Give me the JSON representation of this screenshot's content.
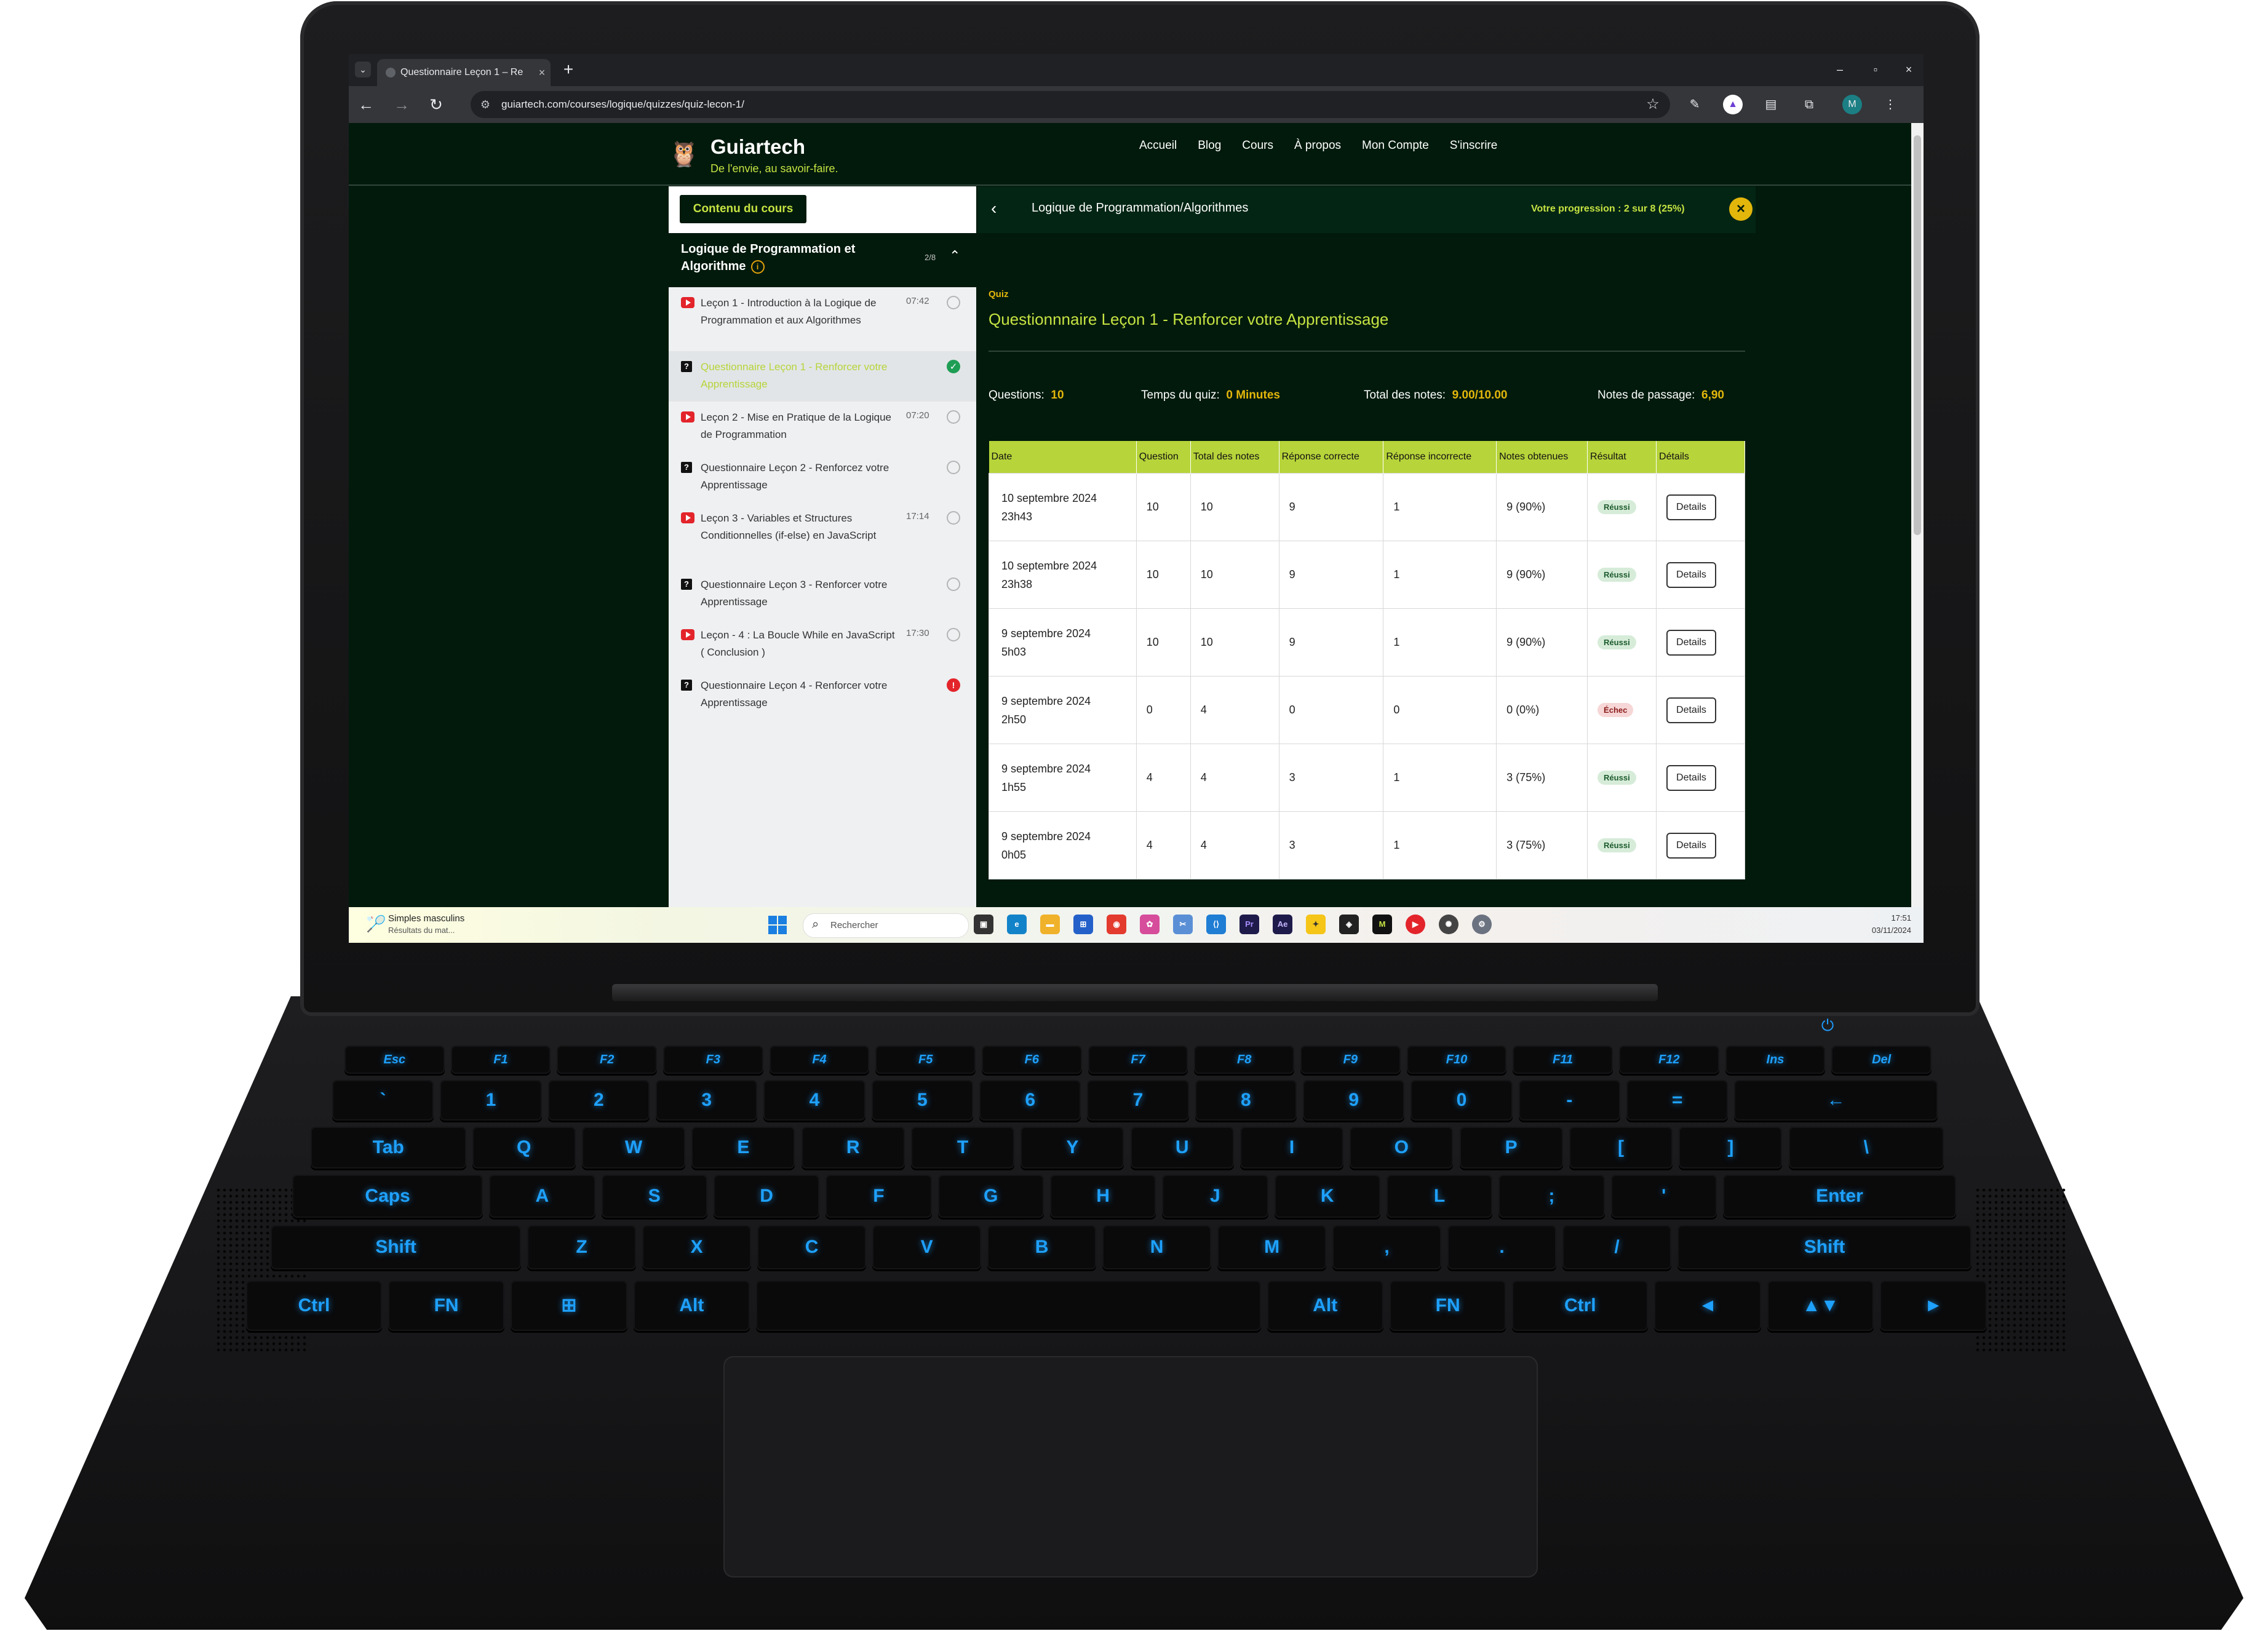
{
  "browser": {
    "tab_title": "Questionnaire Leçon 1 – Re",
    "url": "guiartech.com/courses/logique/quizzes/quiz-lecon-1/",
    "profile_initial": "M"
  },
  "site": {
    "name": "Guiartech",
    "tagline": "De l'envie, au savoir-faire.",
    "nav": [
      "Accueil",
      "Blog",
      "Cours",
      "À propos",
      "Mon Compte",
      "S'inscrire"
    ]
  },
  "sidebar": {
    "button_label": "Contenu du cours",
    "module_title": "Logique de Programmation et Algorithme",
    "module_count": "2/8",
    "lessons": [
      {
        "title": "Leçon 1 - Introduction à la Logique de Programmation et aux Algorithmes",
        "time": "07:42",
        "type": "video",
        "status": "pending"
      },
      {
        "title": "Questionnaire Leçon 1 - Renforcer votre Apprentissage",
        "time": "",
        "type": "quiz",
        "status": "done"
      },
      {
        "title": "Leçon 2 - Mise en Pratique de la Logique de Programmation",
        "time": "07:20",
        "type": "video",
        "status": "pending"
      },
      {
        "title": "Questionnaire Leçon 2 - Renforcez votre Apprentissage",
        "time": "",
        "type": "quiz",
        "status": "pending"
      },
      {
        "title": "Leçon 3 - Variables et Structures Conditionnelles (if-else) en JavaScript",
        "time": "17:14",
        "type": "video",
        "status": "pending"
      },
      {
        "title": "Questionnaire Leçon 3 - Renforcer votre Apprentissage",
        "time": "",
        "type": "quiz",
        "status": "pending"
      },
      {
        "title": "Leçon - 4 : La Boucle While en JavaScript ( Conclusion )",
        "time": "17:30",
        "type": "video",
        "status": "pending"
      },
      {
        "title": "Questionnaire Leçon 4 - Renforcer votre Apprentissage",
        "time": "",
        "type": "quiz",
        "status": "alert"
      }
    ]
  },
  "content": {
    "course_title": "Logique de Programmation/Algorithmes",
    "progress_label": "Votre progression : 2 sur 8 (25%)",
    "quiz_tag": "Quiz",
    "quiz_title": "Questionnnaire Leçon 1 - Renforcer votre Apprentissage",
    "meta": {
      "questions_label": "Questions:",
      "questions_value": "10",
      "time_label": "Temps du quiz:",
      "time_value": "0 Minutes",
      "total_label": "Total des notes:",
      "total_value": "9.00/10.00",
      "pass_label": "Notes de passage:",
      "pass_value": "6,90"
    },
    "table": {
      "headers": [
        "Date",
        "Question",
        "Total des notes",
        "Réponse correcte",
        "Réponse incorrecte",
        "Notes obtenues",
        "Résultat",
        "Détails"
      ],
      "rows": [
        {
          "date": "10 septembre 2024",
          "time": "23h43",
          "question": "10",
          "total": "10",
          "correct": "9",
          "incorrect": "1",
          "obtained": "9 (90%)",
          "result": "Réussi",
          "details": "Details"
        },
        {
          "date": "10 septembre 2024",
          "time": "23h38",
          "question": "10",
          "total": "10",
          "correct": "9",
          "incorrect": "1",
          "obtained": "9 (90%)",
          "result": "Réussi",
          "details": "Details"
        },
        {
          "date": "9 septembre 2024",
          "time": "5h03",
          "question": "10",
          "total": "10",
          "correct": "9",
          "incorrect": "1",
          "obtained": "9 (90%)",
          "result": "Réussi",
          "details": "Details"
        },
        {
          "date": "9 septembre 2024",
          "time": "2h50",
          "question": "0",
          "total": "4",
          "correct": "0",
          "incorrect": "0",
          "obtained": "0 (0%)",
          "result": "Échec",
          "details": "Details"
        },
        {
          "date": "9 septembre 2024",
          "time": "1h55",
          "question": "4",
          "total": "4",
          "correct": "3",
          "incorrect": "1",
          "obtained": "3 (75%)",
          "result": "Réussi",
          "details": "Details"
        },
        {
          "date": "9 septembre 2024",
          "time": "0h05",
          "question": "4",
          "total": "4",
          "correct": "3",
          "incorrect": "1",
          "obtained": "3 (75%)",
          "result": "Réussi",
          "details": "Details"
        }
      ]
    }
  },
  "taskbar": {
    "widget_title": "Simples masculins",
    "widget_sub": "Résultats du mat...",
    "search_placeholder": "Rechercher",
    "time": "17:51",
    "date": "03/11/2024"
  },
  "keyboard": {
    "rows": [
      [
        "Esc",
        "F1",
        "F2",
        "F3",
        "F4",
        "F5",
        "F6",
        "F7",
        "F8",
        "F9",
        "F10",
        "F11",
        "F12",
        "Ins",
        "Del"
      ],
      [
        "`",
        "1",
        "2",
        "3",
        "4",
        "5",
        "6",
        "7",
        "8",
        "9",
        "0",
        "-",
        "=",
        "←"
      ],
      [
        "Tab",
        "Q",
        "W",
        "E",
        "R",
        "T",
        "Y",
        "U",
        "I",
        "O",
        "P",
        "[",
        "]",
        "\\"
      ],
      [
        "Caps",
        "A",
        "S",
        "D",
        "F",
        "G",
        "H",
        "J",
        "K",
        "L",
        ";",
        "'",
        "Enter"
      ],
      [
        "Shift",
        "Z",
        "X",
        "C",
        "V",
        "B",
        "N",
        "M",
        ",",
        ".",
        "/",
        "Shift"
      ],
      [
        "Ctrl",
        "FN",
        "⊞",
        "Alt",
        "",
        "Alt",
        "FN",
        "Ctrl",
        "◄",
        "▲▼",
        "►"
      ]
    ]
  },
  "colors": {
    "page_bg": "#011a0c",
    "accent_green": "#c6e342",
    "accent_yellow": "#e3b60b",
    "table_header": "#b7d43a",
    "keyboard_glow": "#1ea1ff"
  }
}
